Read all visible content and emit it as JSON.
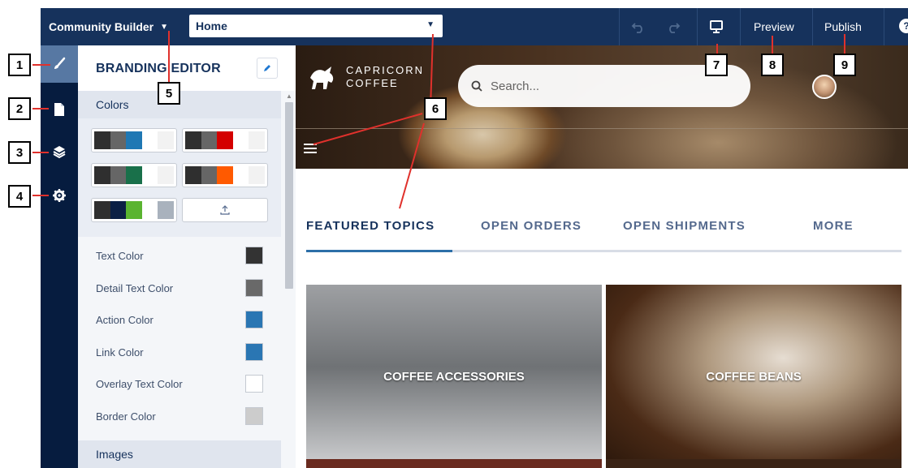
{
  "topbar": {
    "app_menu_label": "Community Builder",
    "page_selector_value": "Home",
    "preview_label": "Preview",
    "publish_label": "Publish",
    "help_label": "?"
  },
  "panel": {
    "title": "BRANDING EDITOR",
    "colors_section": "Colors",
    "images_section": "Images",
    "palettes": [
      [
        "#2f2f2f",
        "#666666",
        "#1f78b4",
        "#ffffff",
        "#f2f2f2"
      ],
      [
        "#2f2f2f",
        "#666666",
        "#d40000",
        "#ffffff",
        "#f2f2f2"
      ],
      [
        "#2f2f2f",
        "#666666",
        "#19704a",
        "#ffffff",
        "#f2f2f2"
      ],
      [
        "#2f2f2f",
        "#666666",
        "#ff5a00",
        "#ffffff",
        "#f2f2f2"
      ],
      [
        "#2f2f2f",
        "#0b1f44",
        "#5ab430",
        "#ffffff",
        "#a9b2bd"
      ]
    ],
    "color_rows": [
      {
        "label": "Text Color",
        "color": "#333333"
      },
      {
        "label": "Detail Text Color",
        "color": "#696969"
      },
      {
        "label": "Action Color",
        "color": "#2a76b3"
      },
      {
        "label": "Link Color",
        "color": "#2a76b3"
      },
      {
        "label": "Overlay Text Color",
        "color": "#ffffff"
      },
      {
        "label": "Border Color",
        "color": "#cccccc"
      }
    ]
  },
  "preview": {
    "brand_line1": "CAPRICORN",
    "brand_line2": "COFFEE",
    "search_placeholder": "Search...",
    "tabs": [
      "FEATURED TOPICS",
      "OPEN ORDERS",
      "OPEN SHIPMENTS",
      "MORE"
    ],
    "tiles": [
      "COFFEE ACCESSORIES",
      "COFFEE BEANS"
    ]
  },
  "callouts": [
    "1",
    "2",
    "3",
    "4",
    "5",
    "6",
    "7",
    "8",
    "9"
  ],
  "colors": {
    "navy": "#16325c",
    "rail": "#061c3f",
    "rail_active": "#5778a3",
    "callout_line": "#e0312c"
  }
}
